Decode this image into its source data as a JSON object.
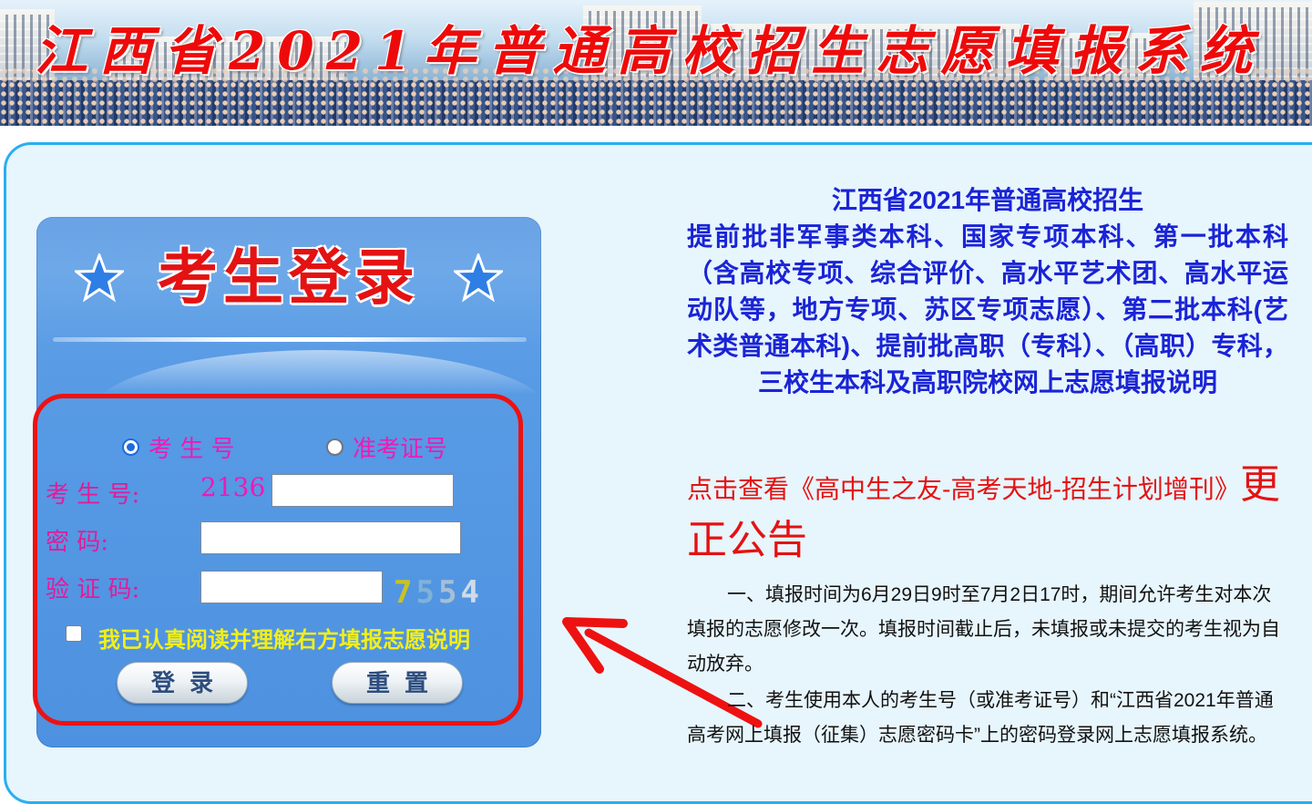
{
  "banner": {
    "title": "江西省2021年普通高校招生志愿填报系统"
  },
  "login": {
    "title": "考生登录",
    "radio_exam_no": "考 生 号",
    "radio_admission": "准考证号",
    "label_exam_no": "考 生 号:",
    "exam_no_prefix": "2136",
    "label_password": "密    码:",
    "label_captcha": "验 证 码:",
    "captcha_digits": [
      "7",
      "5",
      "5",
      "4"
    ],
    "agree_text": "我已认真阅读并理解右方填报志愿说明",
    "login_button": "登录",
    "reset_button": "重置"
  },
  "notice": {
    "heading_line1": "江西省2021年普通高校招生",
    "heading_body": "提前批非军事类本科、国家专项本科、第一批本科（含高校专项、综合评价、高水平艺术团、高水平运动队等，地方专项、苏区专项志愿）、第二批本科(艺术类普通本科)、提前批高职（专科）、（高职）专科，三校生本科及高职院校网上志愿填报说明",
    "link_text": "点击查看《高中生之友-高考天地-招生计划增刊》",
    "link_suffix": "更正公告",
    "para1": "一、填报时间为6月29日9时至7月2日17时，期间允许考生对本次填报的志愿修改一次。填报时间截止后，未填报或未提交的考生视为自动放弃。",
    "para2": "二、考生使用本人的考生号（或准考证号）和“江西省2021年普通高考网上填报（征集）志愿密码卡”上的密码登录网上志愿填报系统。"
  }
}
